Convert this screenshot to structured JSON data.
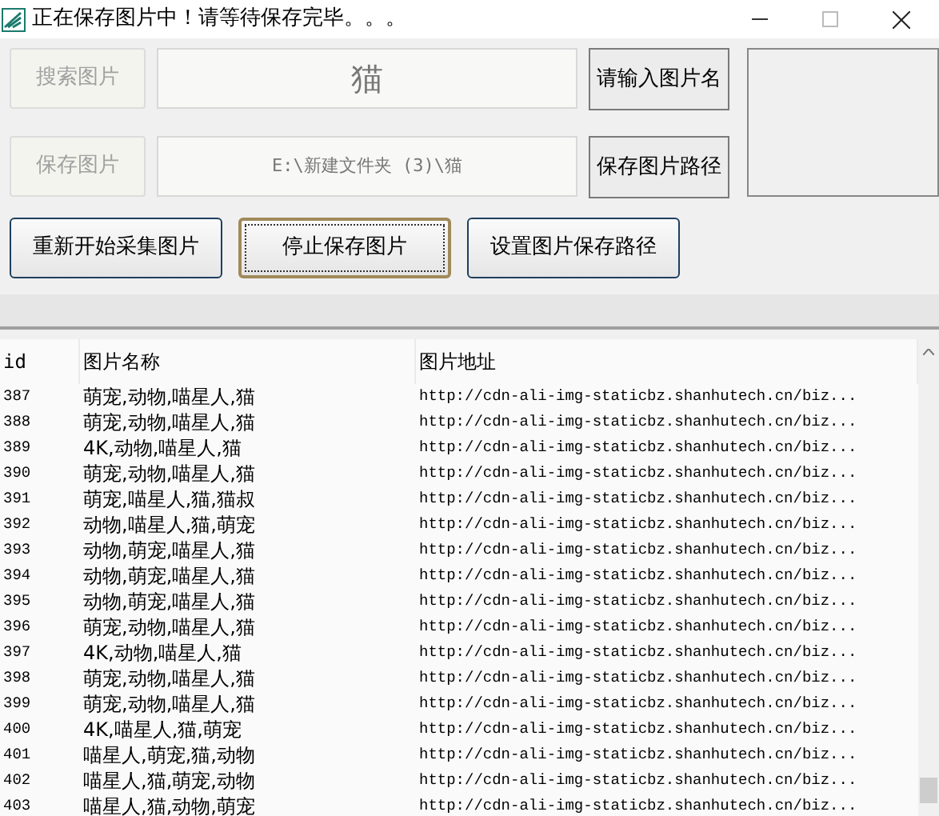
{
  "window": {
    "title": "正在保存图片中！请等待保存完毕。。。"
  },
  "search_row": {
    "button": {
      "label": "搜索图片",
      "disabled": true
    },
    "field": {
      "value": "猫",
      "disabled": true
    },
    "hint_button": {
      "label": "请输入图片名"
    }
  },
  "path_row": {
    "button": {
      "label": "保存图片",
      "disabled": true
    },
    "field": {
      "value": "E:\\新建文件夹 (3)\\猫",
      "disabled": true
    },
    "hint_button": {
      "label": "保存图片路径"
    }
  },
  "actions": [
    {
      "label": "重新开始采集图片",
      "focused": false
    },
    {
      "label": "停止保存图片",
      "focused": true
    },
    {
      "label": "设置图片保存路径",
      "focused": false
    }
  ],
  "table": {
    "columns": [
      "id",
      "图片名称",
      "图片地址"
    ],
    "rows": [
      [
        "387",
        "萌宠,动物,喵星人,猫",
        "http://cdn-ali-img-staticbz.shanhutech.cn/biz..."
      ],
      [
        "388",
        "萌宠,动物,喵星人,猫",
        "http://cdn-ali-img-staticbz.shanhutech.cn/biz..."
      ],
      [
        "389",
        "4K,动物,喵星人,猫",
        "http://cdn-ali-img-staticbz.shanhutech.cn/biz..."
      ],
      [
        "390",
        "萌宠,动物,喵星人,猫",
        "http://cdn-ali-img-staticbz.shanhutech.cn/biz..."
      ],
      [
        "391",
        "萌宠,喵星人,猫,猫叔",
        "http://cdn-ali-img-staticbz.shanhutech.cn/biz..."
      ],
      [
        "392",
        "动物,喵星人,猫,萌宠",
        "http://cdn-ali-img-staticbz.shanhutech.cn/biz..."
      ],
      [
        "393",
        "动物,萌宠,喵星人,猫",
        "http://cdn-ali-img-staticbz.shanhutech.cn/biz..."
      ],
      [
        "394",
        "动物,萌宠,喵星人,猫",
        "http://cdn-ali-img-staticbz.shanhutech.cn/biz..."
      ],
      [
        "395",
        "动物,萌宠,喵星人,猫",
        "http://cdn-ali-img-staticbz.shanhutech.cn/biz..."
      ],
      [
        "396",
        "萌宠,动物,喵星人,猫",
        "http://cdn-ali-img-staticbz.shanhutech.cn/biz..."
      ],
      [
        "397",
        "4K,动物,喵星人,猫",
        "http://cdn-ali-img-staticbz.shanhutech.cn/biz..."
      ],
      [
        "398",
        "萌宠,动物,喵星人,猫",
        "http://cdn-ali-img-staticbz.shanhutech.cn/biz..."
      ],
      [
        "399",
        "萌宠,动物,喵星人,猫",
        "http://cdn-ali-img-staticbz.shanhutech.cn/biz..."
      ],
      [
        "400",
        "4K,喵星人,猫,萌宠",
        "http://cdn-ali-img-staticbz.shanhutech.cn/biz..."
      ],
      [
        "401",
        "喵星人,萌宠,猫,动物",
        "http://cdn-ali-img-staticbz.shanhutech.cn/biz..."
      ],
      [
        "402",
        "喵星人,猫,萌宠,动物",
        "http://cdn-ali-img-staticbz.shanhutech.cn/biz..."
      ],
      [
        "403",
        "喵星人,猫,动物,萌宠",
        "http://cdn-ali-img-staticbz.shanhutech.cn/biz..."
      ]
    ]
  }
}
